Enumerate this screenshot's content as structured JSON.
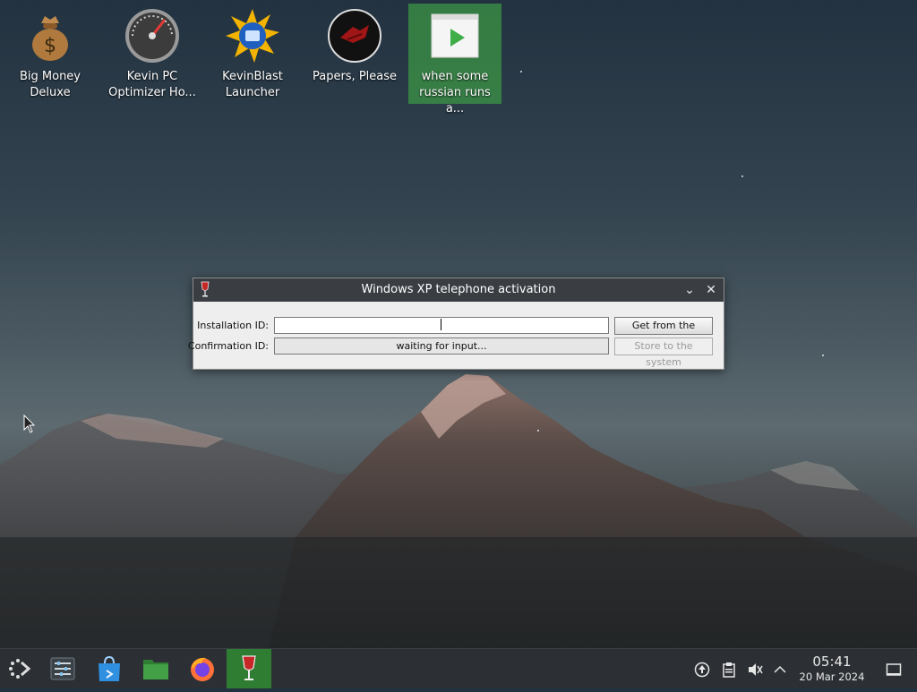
{
  "desktop": {
    "icons": [
      {
        "name": "money-bag-icon",
        "label": "Big Money Deluxe"
      },
      {
        "name": "gauge-icon",
        "label": "Kevin PC Optimizer Ho..."
      },
      {
        "name": "sun-disc-icon",
        "label": "KevinBlast Launcher"
      },
      {
        "name": "papers-please-icon",
        "label": "Papers, Please"
      },
      {
        "name": "video-file-icon",
        "label": "when some russian runs a..."
      }
    ]
  },
  "dialog": {
    "title": "Windows XP telephone activation",
    "installation_label": "Installation ID:",
    "installation_value": "",
    "confirmation_label": "Confirmation ID:",
    "confirmation_value": "waiting for input...",
    "get_button": "Get from the system",
    "store_button": "Store to the system"
  },
  "taskbar": {
    "launcher": "app-launcher-icon",
    "apps": [
      "system-settings-icon",
      "discover-store-icon",
      "file-manager-icon",
      "firefox-icon",
      "wine-glass-icon"
    ],
    "tray": [
      "update-icon",
      "clipboard-icon",
      "volume-muted-icon",
      "chevron-up-icon"
    ],
    "time": "05:41",
    "date": "20 Mar 2024",
    "show_desktop": "show-desktop-icon"
  },
  "colors": {
    "selection": "#3c9646",
    "taskbar": "#2c3034",
    "active_task": "#2e7d32",
    "titlebar": "#3a3e43"
  }
}
